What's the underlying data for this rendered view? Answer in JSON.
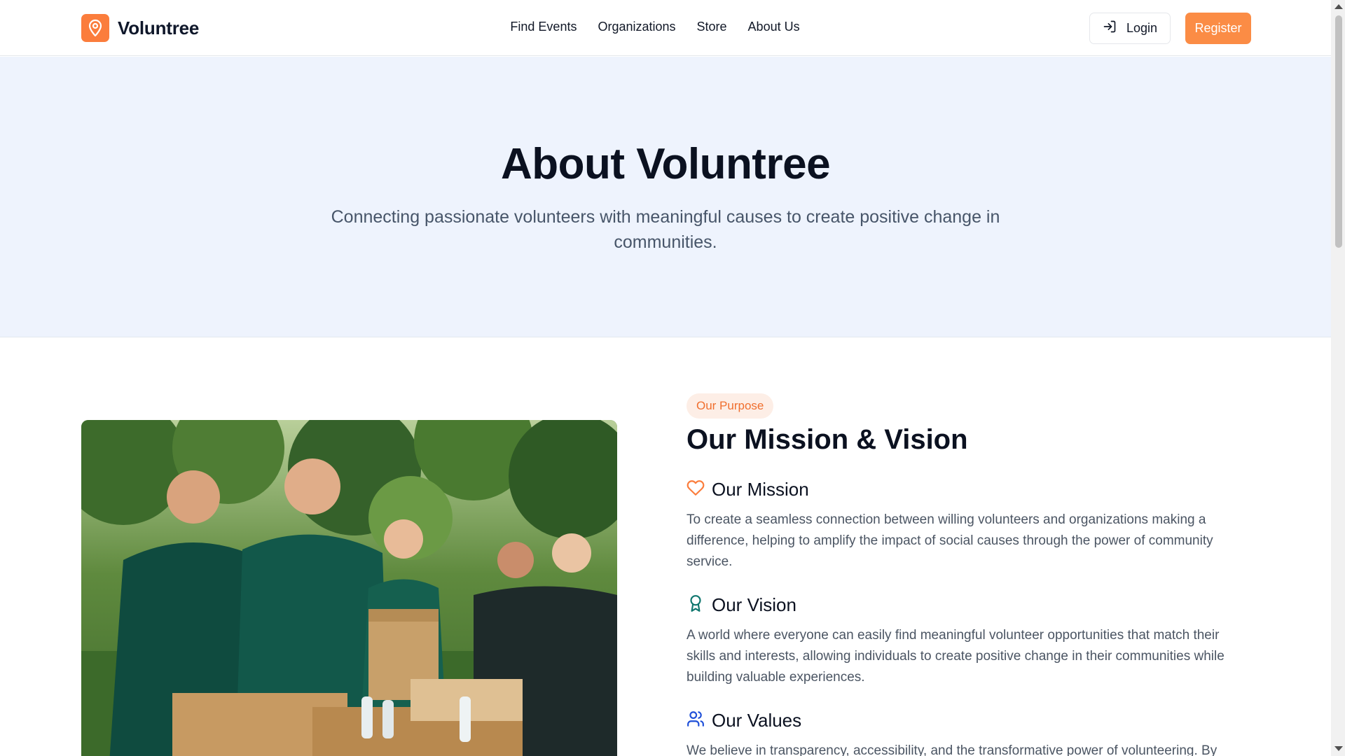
{
  "header": {
    "brand": "Voluntree",
    "nav": [
      "Find Events",
      "Organizations",
      "Store",
      "About Us"
    ],
    "login_label": "Login",
    "register_label": "Register"
  },
  "hero": {
    "title": "About Voluntree",
    "subtitle": "Connecting passionate volunteers with meaningful causes to create positive change in communities."
  },
  "about": {
    "badge": "Our Purpose",
    "title": "Our Mission & Vision",
    "mission": {
      "title": "Our Mission",
      "icon": "heart-icon",
      "text": "To create a seamless connection between willing volunteers and organizations making a difference, helping to amplify the impact of social causes through the power of community service."
    },
    "vision": {
      "title": "Our Vision",
      "icon": "award-icon",
      "text": "A world where everyone can easily find meaningful volunteer opportunities that match their skills and interests, allowing individuals to create positive change in their communities while building valuable experiences."
    },
    "values": {
      "title": "Our Values",
      "icon": "users-icon",
      "text": "We believe in transparency, accessibility, and the transformative power of volunteering. By"
    }
  },
  "colors": {
    "accent": "#fb7d3c",
    "hero_bg": "#eef3fd",
    "heading": "#0b1120",
    "body_text": "#4b5563",
    "teal_icon": "#0f766e",
    "blue_icon": "#1d4ed8"
  }
}
